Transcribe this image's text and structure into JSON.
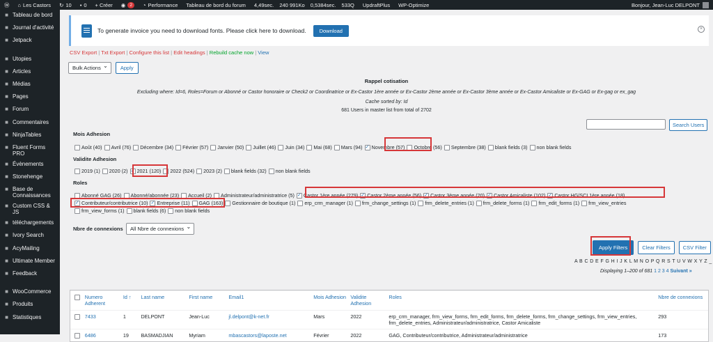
{
  "adminbar": {
    "site": "Les Castors",
    "updates": "10",
    "comments": "0",
    "create": "+ Créer",
    "badge": "2",
    "perf": "Performance",
    "forum_dash": "Tableau de bord du forum",
    "stat1": "4,49sec.",
    "stat2": "240 991Ko",
    "stat3": "0,5384sec.",
    "stat4": "533Q",
    "updraft": "UpdraftPlus",
    "wpopt": "WP-Optimize",
    "greeting": "Bonjour, Jean-Luc DELPONT"
  },
  "sidebar": [
    {
      "label": "Tableau de bord",
      "icon": "dashboard-icon"
    },
    {
      "label": "Journal d'activité",
      "icon": "clock-icon"
    },
    {
      "label": "Jetpack",
      "icon": "jetpack-icon"
    },
    {
      "label": "Utopies",
      "icon": "pin-icon"
    },
    {
      "label": "Articles",
      "icon": "pin-icon"
    },
    {
      "label": "Médias",
      "icon": "media-icon"
    },
    {
      "label": "Pages",
      "icon": "page-icon"
    },
    {
      "label": "Forum",
      "icon": "forum-icon"
    },
    {
      "label": "Commentaires",
      "icon": "comment-icon"
    },
    {
      "label": "NinjaTables",
      "icon": "table-icon"
    },
    {
      "label": "Fluent Forms PRO",
      "icon": "form-icon"
    },
    {
      "label": "Évènements",
      "icon": "calendar-icon"
    },
    {
      "label": "Stonehenge",
      "icon": "gear-icon"
    },
    {
      "label": "Base de Connaissances",
      "icon": "book-icon"
    },
    {
      "label": "Custom CSS & JS",
      "icon": "plus-icon"
    },
    {
      "label": "téléchargements",
      "icon": "download-icon"
    },
    {
      "label": "Ivory Search",
      "icon": "search-icon"
    },
    {
      "label": "AcyMailing",
      "icon": "mail-icon"
    },
    {
      "label": "Ultimate Member",
      "icon": "user-icon"
    },
    {
      "label": "Feedback",
      "icon": "feedback-icon"
    },
    {
      "label": "WooCommerce",
      "icon": "woo-icon"
    },
    {
      "label": "Produits",
      "icon": "box-icon"
    },
    {
      "label": "Statistiques",
      "icon": "chart-icon"
    }
  ],
  "notice": {
    "text": "To generate invoice you need to download fonts. Please click here to download.",
    "button": "Download"
  },
  "links": {
    "csv": "CSV Export",
    "txt": "Txt Export",
    "configure": "Configure this list",
    "edit": "Edit headings",
    "rebuild": "Rebuild cache now",
    "view": "View"
  },
  "bulk": {
    "select": "Bulk Actions",
    "apply": "Apply"
  },
  "info": {
    "title": "Rappel cotisation",
    "excluding": "Excluding where: Id=6, Roles=Forum or Abonné or Castor honoraire or Check2 or Coordinatrice or Ex-Castor 1ère année or Ex-Castor 2ème année or Ex-Castor 3ème année or Ex-Castor Amicaliste or Ex-GAG or Ex-gag or ex_gag",
    "cache": "Cache sorted by: Id",
    "count": "681 Users in master list from total of 2702"
  },
  "search": {
    "button": "Search Users"
  },
  "mois": {
    "title": "Mois Adhesion",
    "items": [
      {
        "t": "Août (40)",
        "c": false
      },
      {
        "t": "Avril (76)",
        "c": false
      },
      {
        "t": "Décembre (34)",
        "c": false
      },
      {
        "t": "Février (57)",
        "c": false
      },
      {
        "t": "Janvier (50)",
        "c": false
      },
      {
        "t": "Juillet (46)",
        "c": false
      },
      {
        "t": "Juin (34)",
        "c": false
      },
      {
        "t": "Mai (68)",
        "c": false
      },
      {
        "t": "Mars (94)",
        "c": false
      },
      {
        "t": "Novembre (57)",
        "c": true
      },
      {
        "t": "Octobre (56)",
        "c": false
      },
      {
        "t": "Septembre (38)",
        "c": false
      },
      {
        "t": "blank fields (3)",
        "c": false
      },
      {
        "t": "non blank fields",
        "c": false
      }
    ]
  },
  "validite": {
    "title": "Validite Adhesion",
    "items": [
      {
        "t": "2019 (1)",
        "c": false
      },
      {
        "t": "2020 (2)",
        "c": false
      },
      {
        "t": "2021 (120)",
        "c": true
      },
      {
        "t": "2022 (524)",
        "c": false
      },
      {
        "t": "2023 (2)",
        "c": false
      },
      {
        "t": "blank fields (32)",
        "c": false
      },
      {
        "t": "non blank fields",
        "c": false
      }
    ]
  },
  "roles": {
    "title": "Roles",
    "line1": [
      {
        "t": "Abonné GAG (26)",
        "c": false
      },
      {
        "t": "Abonné/abonnée (23)",
        "c": false
      },
      {
        "t": "Accueil (2)",
        "c": false
      },
      {
        "t": "Administrateur/administratrice (5)",
        "c": false
      },
      {
        "t": "Castor 1ère année (279)",
        "c": true
      },
      {
        "t": "Castor 2ème année (56)",
        "c": true
      },
      {
        "t": "Castor 3ème année (20)",
        "c": true
      },
      {
        "t": "Castor Amicaliste (102)",
        "c": true
      },
      {
        "t": "Castor HG/SCI 1ère année (18)",
        "c": true
      }
    ],
    "line2": [
      {
        "t": "Contributeur/contributrice (10)",
        "c": true
      },
      {
        "t": "Entreprise (11)",
        "c": true
      },
      {
        "t": "GAG (163)",
        "c": false
      },
      {
        "t": "Gestionnaire de boutique (1)",
        "c": false
      },
      {
        "t": "erp_crm_manager (1)",
        "c": false
      },
      {
        "t": "frm_change_settings (1)",
        "c": false
      },
      {
        "t": "frm_delete_entries (1)",
        "c": false
      },
      {
        "t": "frm_delete_forms (1)",
        "c": false
      },
      {
        "t": "frm_edit_forms (1)",
        "c": false
      },
      {
        "t": "frm_view_entries",
        "c": false
      }
    ],
    "line3": [
      {
        "t": "frm_view_forms (1)",
        "c": false
      },
      {
        "t": "blank fields (6)",
        "c": false
      },
      {
        "t": "non blank fields",
        "c": false
      }
    ]
  },
  "connexions": {
    "title": "Nbre de connexions",
    "select": "All Nbre de connexions"
  },
  "filters": {
    "apply": "Apply Filters",
    "clear": "Clear Filters",
    "csv": "CSV Filter"
  },
  "letters": "A B C D E F G H I J K L M N O P Q R S T U V W X Y Z _ ↗ «",
  "paging": {
    "text": "Displaying 1–200 of 681",
    "p1": "1",
    "p2": "2",
    "p3": "3",
    "p4": "4",
    "next": "Suivant »"
  },
  "table": {
    "headers": [
      "Numero Adherent",
      "Id ↑",
      "Last name",
      "First name",
      "Email1",
      "Mois Adhesion",
      "Validite Adhesion",
      "Roles",
      "Nbre de connexions"
    ],
    "rows": [
      [
        "7433",
        "1",
        "DELPONT",
        "Jean-Luc",
        "jl.delpont@k-net.fr",
        "Mars",
        "2022",
        "erp_crm_manager, frm_view_forms, frm_edit_forms, frm_delete_forms, frm_change_settings, frm_view_entries, frm_delete_entries, Administrateur/administratrice, Castor Amicaliste",
        "293"
      ],
      [
        "6486",
        "19",
        "BASMADJIAN",
        "Myriam",
        "mbascastors@laposte.net",
        "Février",
        "2022",
        "GAG, Contributeur/contributrice, Administrateur/administratrice",
        "173"
      ]
    ]
  }
}
